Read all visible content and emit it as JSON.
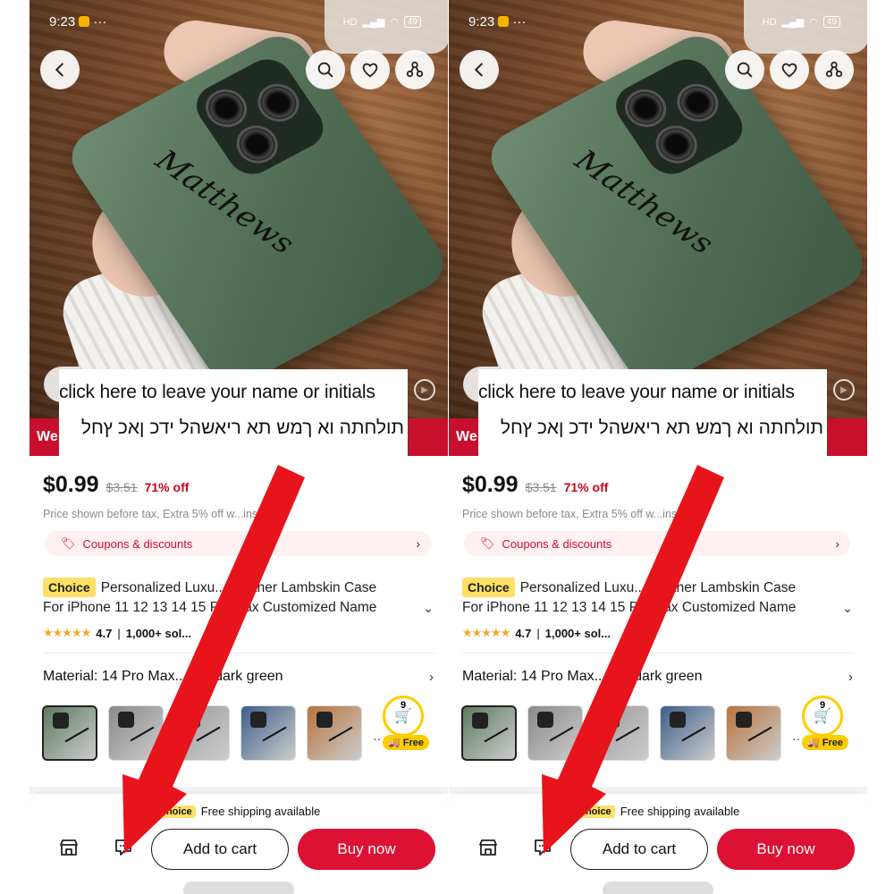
{
  "accent_red": "#dd1133",
  "choice_yellow": "#ffe066",
  "screens": [
    {
      "status": {
        "time": "9:23",
        "dots": "···",
        "network": "HD",
        "battery": "49"
      },
      "top_buttons": {
        "back": "chevron-left-icon",
        "search": "search-icon",
        "wishlist": "heart-icon",
        "share": "share-icon"
      },
      "overlay": {
        "english": "click here to leave your name or initials",
        "hebrew": "תולחתה וא ךמש תא ריאשהל ידכ ןאכ ץחל"
      },
      "strip_text": "We",
      "price": {
        "current": "$0.99",
        "original": "$3.51",
        "discount": "71% off"
      },
      "tax_note": "Price shown before tax, Extra 5% off w...ins",
      "coupons": "Coupons & discounts",
      "choice_badge": "Choice",
      "title_line1": "Personalized Luxu... Leather Lambskin Case",
      "title_line2": "For iPhone 11 12 13 14 15 P... Max Customized Name",
      "rating": {
        "stars": "★★★★★",
        "score": "4.7",
        "sold": "1,000+ sol..."
      },
      "material": "Material: 14 Pro Max... lor: dark green",
      "swatch_colors": [
        "#5d7a60",
        "#8a8a8a",
        "#9a9a9a",
        "#3e5f8a",
        "#b8743e"
      ],
      "cart_count": "9",
      "free_label": "Free",
      "shipping": {
        "badge": "Choice",
        "text": "Free shipping available"
      },
      "actions": {
        "add_to_cart": "Add to cart",
        "buy_now": "Buy now"
      }
    },
    {
      "status": {
        "time": "9:23",
        "dots": "···",
        "network": "HD",
        "battery": "49"
      },
      "top_buttons": {
        "back": "chevron-left-icon",
        "search": "search-icon",
        "wishlist": "heart-icon",
        "share": "share-icon"
      },
      "overlay": {
        "english": "click here to leave your name or initials",
        "hebrew": "תולחתה וא ךמש תא ריאשהל ידכ ןאכ ץחל"
      },
      "strip_text": "We",
      "price": {
        "current": "$0.99",
        "original": "$3.51",
        "discount": "71% off"
      },
      "tax_note": "Price shown before tax, Extra 5% off w...ins",
      "coupons": "Coupons & discounts",
      "choice_badge": "Choice",
      "title_line1": "Personalized Luxu... Leather Lambskin Case",
      "title_line2": "For iPhone 11 12 13 14 15 P... Max Customized Name",
      "rating": {
        "stars": "★★★★★",
        "score": "4.7",
        "sold": "1,000+ sol..."
      },
      "material": "Material: 14 Pro Max... lor: dark green",
      "swatch_colors": [
        "#5d7a60",
        "#8a8a8a",
        "#9a9a9a",
        "#3e5f8a",
        "#b8743e"
      ],
      "cart_count": "9",
      "free_label": "Free",
      "shipping": {
        "badge": "Choice",
        "text": "Free shipping available"
      },
      "actions": {
        "add_to_cart": "Add to cart",
        "buy_now": "Buy now"
      }
    }
  ]
}
